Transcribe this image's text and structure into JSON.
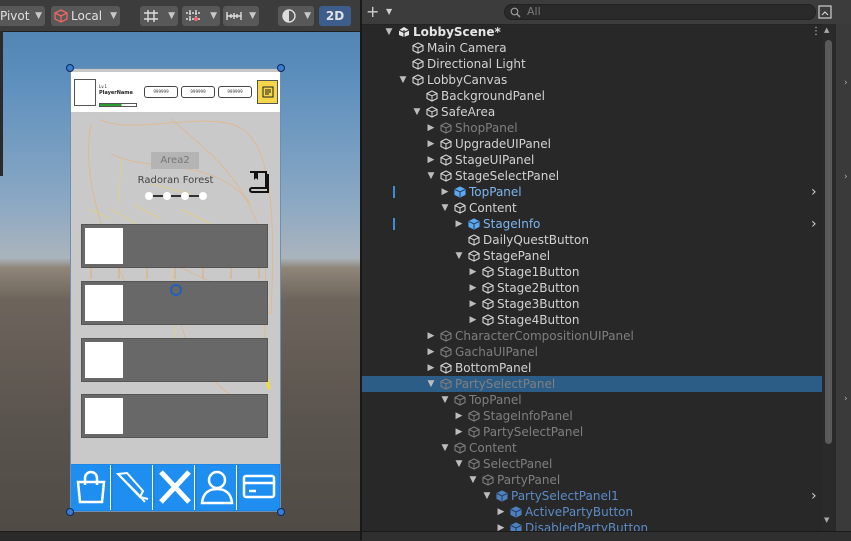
{
  "scene_toolbar": {
    "pivot_label": "Pivot",
    "local_label": "Local",
    "mode_2d_label": "2D"
  },
  "game_ui": {
    "player_level": "Lv.1",
    "player_name": "PlayerName",
    "exp_progress": 0.6,
    "resources": [
      "999999",
      "999999",
      "999999"
    ],
    "area_badge": "Area2",
    "area_name": "Radoran Forest",
    "stage_dots": 4,
    "stage_buttons": 4,
    "bottom_nav": [
      "shop-icon",
      "gacha-icon",
      "battle-icon",
      "character-icon",
      "card-icon"
    ],
    "accent_color": "#1e8ff0"
  },
  "hierarchy": {
    "search_placeholder": "All",
    "rows": [
      {
        "label": "LobbyScene*",
        "depth": 0,
        "expand": "open",
        "icon": "unity-scene-icon",
        "style": "scene",
        "more": "⋮"
      },
      {
        "label": "Main Camera",
        "depth": 1,
        "expand": "none",
        "icon": "gameobject-icon",
        "style": "normal"
      },
      {
        "label": "Directional Light",
        "depth": 1,
        "expand": "none",
        "icon": "gameobject-icon",
        "style": "normal"
      },
      {
        "label": "LobbyCanvas",
        "depth": 1,
        "expand": "open",
        "icon": "gameobject-icon",
        "style": "normal"
      },
      {
        "label": "BackgroundPanel",
        "depth": 2,
        "expand": "none",
        "icon": "gameobject-icon",
        "style": "normal"
      },
      {
        "label": "SafeArea",
        "depth": 2,
        "expand": "open",
        "icon": "gameobject-icon",
        "style": "normal"
      },
      {
        "label": "ShopPanel",
        "depth": 3,
        "expand": "closed",
        "icon": "gameobject-icon",
        "style": "dim"
      },
      {
        "label": "UpgradeUIPanel",
        "depth": 3,
        "expand": "closed",
        "icon": "gameobject-icon",
        "style": "normal"
      },
      {
        "label": "StageUIPanel",
        "depth": 3,
        "expand": "closed",
        "icon": "gameobject-icon",
        "style": "normal"
      },
      {
        "label": "StageSelectPanel",
        "depth": 3,
        "expand": "open",
        "icon": "gameobject-icon",
        "style": "normal"
      },
      {
        "label": "TopPanel",
        "depth": 4,
        "expand": "closed",
        "icon": "prefab-icon",
        "style": "blue",
        "marker": true,
        "arrow": true
      },
      {
        "label": "Content",
        "depth": 4,
        "expand": "open",
        "icon": "gameobject-icon",
        "style": "normal"
      },
      {
        "label": "StageInfo",
        "depth": 5,
        "expand": "closed",
        "icon": "prefab-icon",
        "style": "blue",
        "marker": true,
        "arrow": true
      },
      {
        "label": "DailyQuestButton",
        "depth": 5,
        "expand": "none",
        "icon": "gameobject-icon",
        "style": "normal"
      },
      {
        "label": "StagePanel",
        "depth": 5,
        "expand": "open",
        "icon": "gameobject-icon",
        "style": "normal"
      },
      {
        "label": "Stage1Button",
        "depth": 6,
        "expand": "closed",
        "icon": "gameobject-icon",
        "style": "normal"
      },
      {
        "label": "Stage2Button",
        "depth": 6,
        "expand": "closed",
        "icon": "gameobject-icon",
        "style": "normal"
      },
      {
        "label": "Stage3Button",
        "depth": 6,
        "expand": "closed",
        "icon": "gameobject-icon",
        "style": "normal"
      },
      {
        "label": "Stage4Button",
        "depth": 6,
        "expand": "closed",
        "icon": "gameobject-icon",
        "style": "normal"
      },
      {
        "label": "CharacterCompositionUIPanel",
        "depth": 3,
        "expand": "closed",
        "icon": "gameobject-icon",
        "style": "dim"
      },
      {
        "label": "GachaUIPanel",
        "depth": 3,
        "expand": "closed",
        "icon": "gameobject-icon",
        "style": "dim"
      },
      {
        "label": "BottomPanel",
        "depth": 3,
        "expand": "closed",
        "icon": "gameobject-icon",
        "style": "normal"
      },
      {
        "label": "PartySelectPanel",
        "depth": 3,
        "expand": "open",
        "icon": "gameobject-icon",
        "style": "dim",
        "selected": true
      },
      {
        "label": "TopPanel",
        "depth": 4,
        "expand": "open",
        "icon": "gameobject-icon",
        "style": "dim"
      },
      {
        "label": "StageInfoPanel",
        "depth": 5,
        "expand": "closed",
        "icon": "gameobject-icon",
        "style": "dim"
      },
      {
        "label": "PartySelectPanel",
        "depth": 5,
        "expand": "closed",
        "icon": "gameobject-icon",
        "style": "dim"
      },
      {
        "label": "Content",
        "depth": 4,
        "expand": "open",
        "icon": "gameobject-icon",
        "style": "dim"
      },
      {
        "label": "SelectPanel",
        "depth": 5,
        "expand": "open",
        "icon": "gameobject-icon",
        "style": "dim"
      },
      {
        "label": "PartyPanel",
        "depth": 6,
        "expand": "open",
        "icon": "gameobject-icon",
        "style": "dim"
      },
      {
        "label": "PartySelectPanel1",
        "depth": 7,
        "expand": "open",
        "icon": "prefab-icon",
        "style": "bluedim",
        "arrow": true
      },
      {
        "label": "ActivePartyButton",
        "depth": 8,
        "expand": "closed",
        "icon": "prefab-icon",
        "style": "bluedim"
      },
      {
        "label": "DisabledPartyButton",
        "depth": 8,
        "expand": "closed",
        "icon": "prefab-icon",
        "style": "bluedim"
      }
    ]
  }
}
